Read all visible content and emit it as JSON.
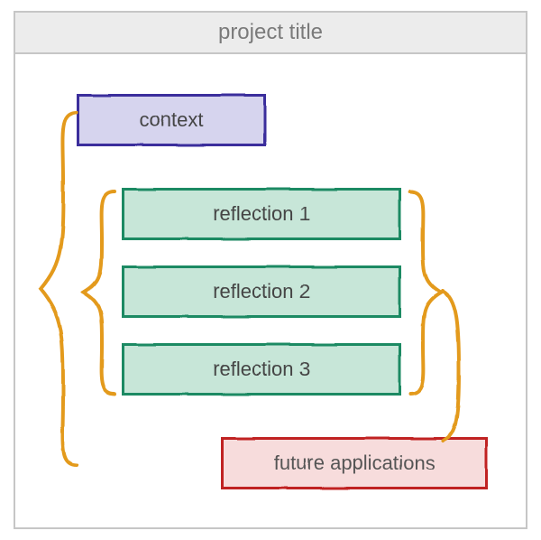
{
  "title": "project title",
  "boxes": {
    "context": "context",
    "reflection1": "reflection 1",
    "reflection2": "reflection 2",
    "reflection3": "reflection 3",
    "future": "future applications"
  },
  "colors": {
    "context_fill": "#d6d4ee",
    "context_border": "#3a2f9c",
    "reflection_fill": "#c7e6d8",
    "reflection_border": "#1f8a63",
    "future_fill": "#f7dcdc",
    "future_border": "#c02424",
    "brace": "#e39a1f",
    "frame_border": "#c6c6c6",
    "title_bg": "#ececec",
    "title_text": "#7a7a7a"
  }
}
